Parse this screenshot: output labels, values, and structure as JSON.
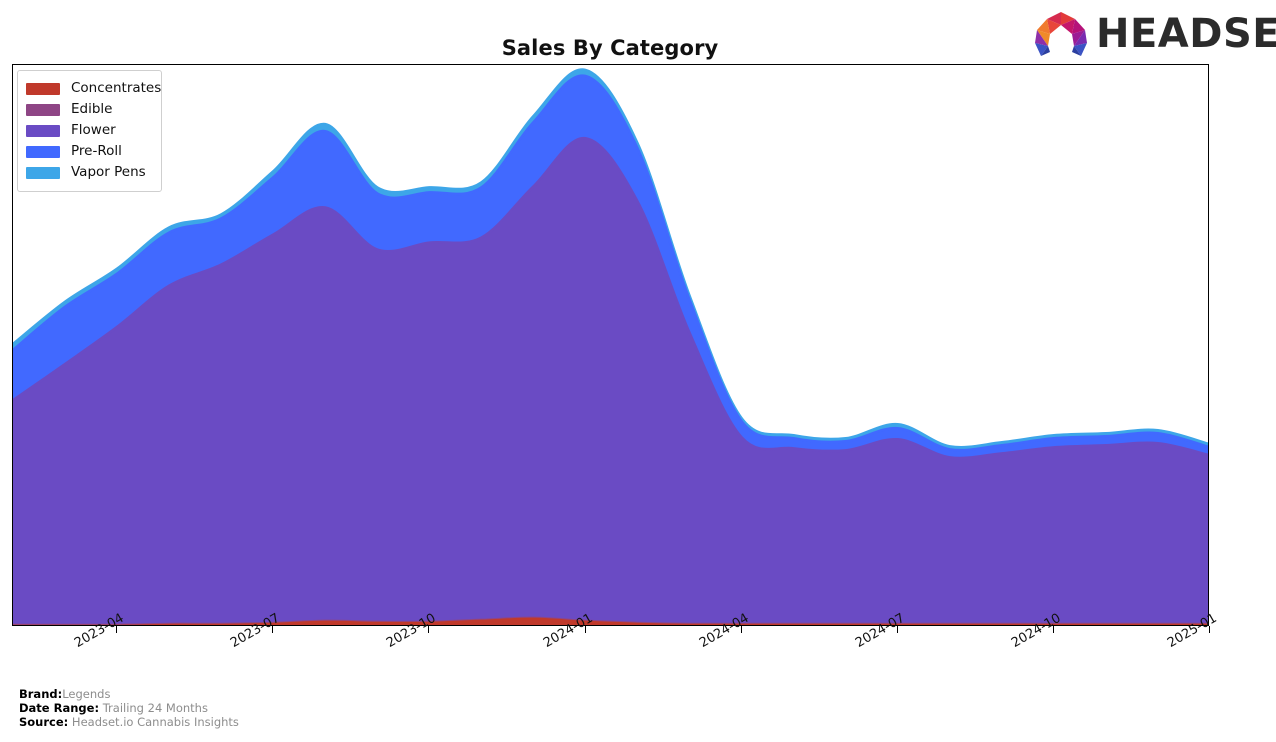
{
  "header": {
    "title": "Sales By Category",
    "logo": {
      "name": "headset-logo",
      "wordmark": "HEADSET",
      "mark_colors": [
        "#F07B2E",
        "#E23B3B",
        "#C4176B",
        "#8E2FA8",
        "#3B53C4",
        "#2B3FA0"
      ]
    }
  },
  "legend": {
    "position": "upper-left",
    "items": [
      {
        "label": "Concentrates",
        "color": "#C0392B"
      },
      {
        "label": "Edible",
        "color": "#8E4585"
      },
      {
        "label": "Flower",
        "color": "#6A4BC4"
      },
      {
        "label": "Pre-Roll",
        "color": "#4169FF"
      },
      {
        "label": "Vapor Pens",
        "color": "#3DA6E8"
      }
    ]
  },
  "footer": {
    "rows": [
      {
        "label": "Brand:",
        "value": "Legends"
      },
      {
        "label": "Date Range:",
        "value": "Trailing 24 Months"
      },
      {
        "label": "Source:",
        "value": "Headset.io Cannabis Insights"
      }
    ]
  },
  "axis": {
    "x_tick_labels": [
      "2023-04",
      "2023-07",
      "2023-10",
      "2024-01",
      "2024-04",
      "2024-07",
      "2024-10",
      "2025-01"
    ],
    "x_tick_months": [
      "2023-04",
      "2023-07",
      "2023-10",
      "2024-01",
      "2024-04",
      "2024-07",
      "2024-10",
      "2025-01"
    ],
    "y_tick_labels": [],
    "grid": false
  },
  "chart_data": {
    "type": "area",
    "stacked": true,
    "title": "Sales By Category",
    "xlabel": "",
    "ylabel": "",
    "grid": false,
    "legend_position": "upper left",
    "smoothing": "spline",
    "x": [
      "2023-02",
      "2023-03",
      "2023-04",
      "2023-05",
      "2023-06",
      "2023-07",
      "2023-08",
      "2023-09",
      "2023-10",
      "2023-11",
      "2023-12",
      "2024-01",
      "2024-02",
      "2024-03",
      "2024-04",
      "2024-05",
      "2024-06",
      "2024-07",
      "2024-08",
      "2024-09",
      "2024-10",
      "2024-11",
      "2024-12",
      "2025-01"
    ],
    "categories": [
      "Concentrates",
      "Edible",
      "Flower",
      "Pre-Roll",
      "Vapor Pens"
    ],
    "series": [
      {
        "name": "Concentrates",
        "color": "#C0392B",
        "values": [
          1,
          1,
          1,
          2,
          2,
          3,
          5,
          4,
          4,
          6,
          8,
          5,
          3,
          2,
          2,
          2,
          2,
          2,
          2,
          2,
          2,
          2,
          2,
          2
        ]
      },
      {
        "name": "Edible",
        "color": "#8E4585",
        "values": [
          1,
          1,
          1,
          1,
          1,
          1,
          1,
          1,
          1,
          1,
          1,
          1,
          1,
          1,
          1,
          1,
          1,
          1,
          1,
          1,
          1,
          1,
          1,
          1
        ]
      },
      {
        "name": "Flower",
        "color": "#6A4BC4",
        "values": [
          224,
          260,
          297,
          337,
          358,
          387,
          412,
          371,
          378,
          381,
          430,
          481,
          420,
          290,
          186,
          175,
          173,
          184,
          166,
          170,
          176,
          178,
          180,
          168
        ]
      },
      {
        "name": "Pre-Roll",
        "color": "#4169FF",
        "values": [
          50,
          57,
          53,
          53,
          46,
          57,
          76,
          56,
          50,
          50,
          64,
          62,
          53,
          33,
          16,
          10,
          9,
          11,
          8,
          8,
          9,
          9,
          10,
          8
        ]
      },
      {
        "name": "Vapor Pens",
        "color": "#3DA6E8",
        "values": [
          6,
          5,
          5,
          5,
          4,
          6,
          7,
          6,
          5,
          5,
          6,
          6,
          5,
          4,
          3,
          3,
          3,
          4,
          3,
          3,
          3,
          3,
          3,
          3
        ]
      }
    ],
    "totals": [
      282,
      324,
      357,
      398,
      411,
      454,
      501,
      438,
      438,
      443,
      509,
      555,
      482,
      330,
      208,
      191,
      188,
      202,
      180,
      184,
      191,
      193,
      196,
      182
    ],
    "ylim": [
      0,
      560
    ],
    "units": "indexed sales"
  }
}
